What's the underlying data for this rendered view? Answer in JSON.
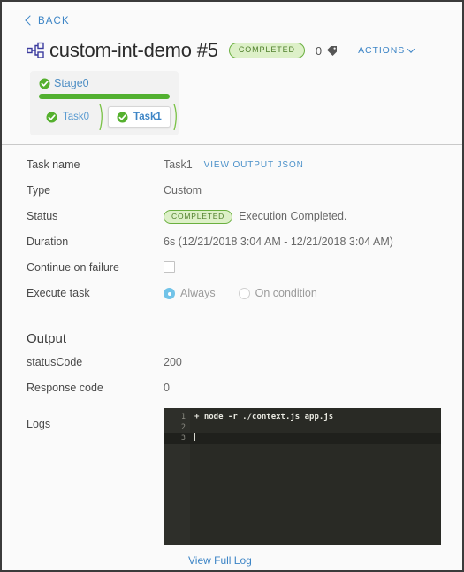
{
  "nav": {
    "back_label": "BACK"
  },
  "header": {
    "icon": "pipeline-icon",
    "title": "custom-int-demo #5",
    "status_badge": "COMPLETED",
    "tag_count": "0",
    "tag_icon": "tag-icon",
    "actions_label": "ACTIONS"
  },
  "pipeline": {
    "stage": {
      "name": "Stage0",
      "status_icon": "check-circle-icon",
      "progress_percent": 100
    },
    "tasks": [
      {
        "name": "Task0",
        "status_icon": "check-circle-icon",
        "selected": false
      },
      {
        "name": "Task1",
        "status_icon": "check-circle-icon",
        "selected": true
      }
    ]
  },
  "details": {
    "task_name": {
      "label": "Task name",
      "value": "Task1",
      "link_label": "VIEW OUTPUT JSON"
    },
    "type": {
      "label": "Type",
      "value": "Custom"
    },
    "status": {
      "label": "Status",
      "badge": "COMPLETED",
      "message": "Execution Completed."
    },
    "duration": {
      "label": "Duration",
      "value": "6s (12/21/2018 3:04 AM - 12/21/2018 3:04 AM)"
    },
    "continue_on_failure": {
      "label": "Continue on failure",
      "checked": false
    },
    "execute_task": {
      "label": "Execute task",
      "options": [
        {
          "label": "Always",
          "selected": true
        },
        {
          "label": "On condition",
          "selected": false
        }
      ]
    }
  },
  "output": {
    "section_title": "Output",
    "status_code": {
      "label": "statusCode",
      "value": "200"
    },
    "response_code": {
      "label": "Response code",
      "value": "0"
    },
    "logs": {
      "label": "Logs",
      "lines": [
        {
          "number": "1",
          "text": "+ node -r ./context.js app.js",
          "active": false
        },
        {
          "number": "2",
          "text": "",
          "active": false
        },
        {
          "number": "3",
          "text": "",
          "active": true
        }
      ],
      "view_full_log_label": "View Full Log"
    }
  },
  "colors": {
    "link": "#3d85c6",
    "success_green": "#52b030",
    "badge_bg": "#ddf0c8",
    "badge_text": "#4f7f2b",
    "console_bg": "#292a25"
  }
}
